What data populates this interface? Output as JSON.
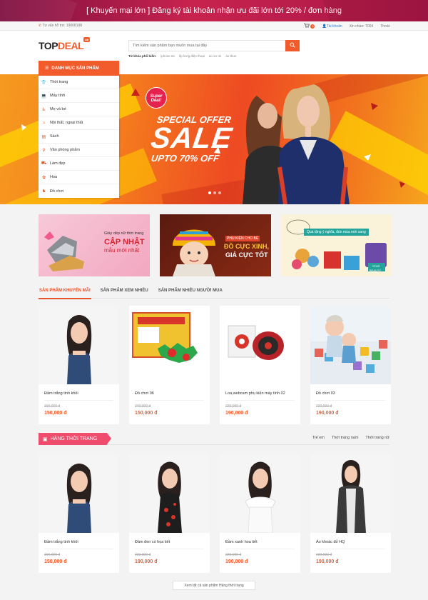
{
  "promo": {
    "text": "[ Khuyến mại lớn ] Đăng ký tài khoản nhận ưu đãi lớn tới 20% / đơn hàng"
  },
  "topbar": {
    "hotline": "Tư vấn hỗ trợ: 19008198",
    "cart_count": "0",
    "account_link": "Tài khoản",
    "greeting": "Xin chào: T004",
    "logout": "Thoát"
  },
  "header": {
    "logo_top": "TOP",
    "logo_deal": "DEAL",
    "logo_tag": "sale"
  },
  "search": {
    "placeholder": "Tìm kiếm sản phẩm bạn muốn mua tại đây",
    "keywords_label": "Từ khóa phổ biến:",
    "keywords": [
      "iphone 6s",
      "ốp lưng điện thoại",
      "áo sơ mi",
      "áo thun"
    ]
  },
  "category_menu": {
    "title": "DANH MỤC SẢN PHẨM",
    "items": [
      {
        "label": "Thời trang",
        "icon": "shirt-icon"
      },
      {
        "label": "Máy tính",
        "icon": "laptop-icon"
      },
      {
        "label": "Mẹ và bé",
        "icon": "stroller-icon"
      },
      {
        "label": "Nội thất, ngoại thất",
        "icon": "sofa-icon"
      },
      {
        "label": "Sách",
        "icon": "book-icon"
      },
      {
        "label": "Văn phòng phẩm",
        "icon": "bicycle-icon"
      },
      {
        "label": "Làm đẹp",
        "icon": "car-icon"
      },
      {
        "label": "Hoa",
        "icon": "flower-icon"
      },
      {
        "label": "Đồ chơi",
        "icon": "toy-icon"
      }
    ]
  },
  "hero": {
    "super_deal": "Super Deal!",
    "special_offer": "SPECIAL OFFER",
    "sale": "SALE",
    "upto": "UPTO 70% OFF",
    "slides": 3,
    "active_slide": 1
  },
  "banners": [
    {
      "line1": "Giày dép nữ thời trang",
      "line2": "CẬP NHẬT",
      "line3": "mẫu mới nhất"
    },
    {
      "line1": "PHỤ KIỆN CHO BÉ",
      "line2": "ĐỒ CỰC XINH,",
      "line3": "GIÁ CỰC TỐT"
    },
    {
      "line1": "Quà tặng ý nghĩa, đón mùa mới sang",
      "line2": "STAR",
      "line3": "BEAUTY"
    }
  ],
  "tabs": [
    {
      "label": "SẢN PHẨM KHUYẾN MÃI",
      "active": true
    },
    {
      "label": "SẢN PHẨM XEM NHIỀU",
      "active": false
    },
    {
      "label": "SẢN PHẨM NHIỀU NGƯỜI MUA",
      "active": false
    }
  ],
  "promo_products": [
    {
      "name": "Đầm trắng tinh khôi",
      "old_price": "190,000 đ",
      "price": "150,000 đ"
    },
    {
      "name": "Đồ chơi 06",
      "old_price": "240,000 đ",
      "price": "150,000 đ"
    },
    {
      "name": "Loa,webcam phụ kiện máy tính 02",
      "old_price": "220,000 đ",
      "price": "190,000 đ"
    },
    {
      "name": "Đồ chơi 03",
      "old_price": "220,000 đ",
      "price": "190,000 đ"
    }
  ],
  "fashion_section": {
    "title": "HÀNG THỜI TRANG",
    "links": [
      "Trẻ em",
      "Thời trang nam",
      "Thời trang nữ"
    ]
  },
  "fashion_products": [
    {
      "name": "Đầm trắng tinh khôi",
      "old_price": "190,000 đ",
      "price": "150,000 đ"
    },
    {
      "name": "Đầm đen có họa tiết",
      "old_price": "220,000 đ",
      "price": "190,000 đ"
    },
    {
      "name": "Đầm xanh hoa tiết",
      "old_price": "220,000 đ",
      "price": "190,000 đ"
    },
    {
      "name": "Áo khoác đỏ HQ",
      "old_price": "220,000 đ",
      "price": "190,000 đ"
    }
  ],
  "view_all": "Xem tất cả sản phẩm Hàng thời trang",
  "colors": {
    "accent": "#f25c2d",
    "promo_bar": "#c8234e",
    "section_pink": "#f04d6e"
  }
}
